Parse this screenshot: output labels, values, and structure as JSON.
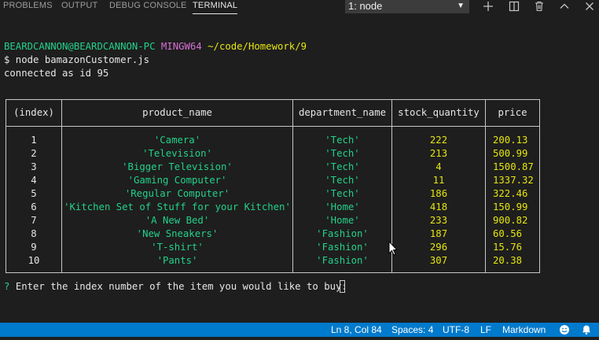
{
  "panel": {
    "tabs": [
      "PROBLEMS",
      "OUTPUT",
      "DEBUG CONSOLE",
      "TERMINAL"
    ],
    "active_tab": "TERMINAL",
    "terminal_selector": "1: node"
  },
  "terminal": {
    "prompt_user": "BEARDCANNON@BEARDCANNON-PC",
    "prompt_env": "MINGW64",
    "prompt_path": "~/code/Homework/9",
    "command": "$ node bamazonCustomer.js",
    "connection": "connected as id 95",
    "question_mark": "?",
    "question": "Enter the index number of the item you would like to buy:"
  },
  "table": {
    "headers": [
      "(index)",
      "product_name",
      "department_name",
      "stock_quantity",
      "price"
    ],
    "rows": [
      [
        "1",
        "'Camera'",
        "'Tech'",
        "222",
        "200.13"
      ],
      [
        "2",
        "'Television'",
        "'Tech'",
        "213",
        "500.99"
      ],
      [
        "3",
        "'Bigger Television'",
        "'Tech'",
        "4",
        "1500.87"
      ],
      [
        "4",
        "'Gaming Computer'",
        "'Tech'",
        "11",
        "1337.32"
      ],
      [
        "5",
        "'Regular Computer'",
        "'Tech'",
        "186",
        "322.46"
      ],
      [
        "6",
        "'Kitchen Set of Stuff for your Kitchen'",
        "'Home'",
        "418",
        "150.99"
      ],
      [
        "7",
        "'A New Bed'",
        "'Home'",
        "233",
        "900.82"
      ],
      [
        "8",
        "'New Sneakers'",
        "'Fashion'",
        "187",
        "60.56"
      ],
      [
        "9",
        "'T-shirt'",
        "'Fashion'",
        "296",
        "15.76"
      ],
      [
        "10",
        "'Pants'",
        "'Fashion'",
        "307",
        "20.38"
      ]
    ]
  },
  "statusbar": {
    "position": "Ln 8, Col 84",
    "spaces": "Spaces: 4",
    "encoding": "UTF-8",
    "eol": "LF",
    "language": "Markdown"
  },
  "colors": {
    "status_bar": "#007acc",
    "string_green": "#23d18b",
    "number_yellow": "#e5e510",
    "env_magenta": "#d670d6"
  }
}
